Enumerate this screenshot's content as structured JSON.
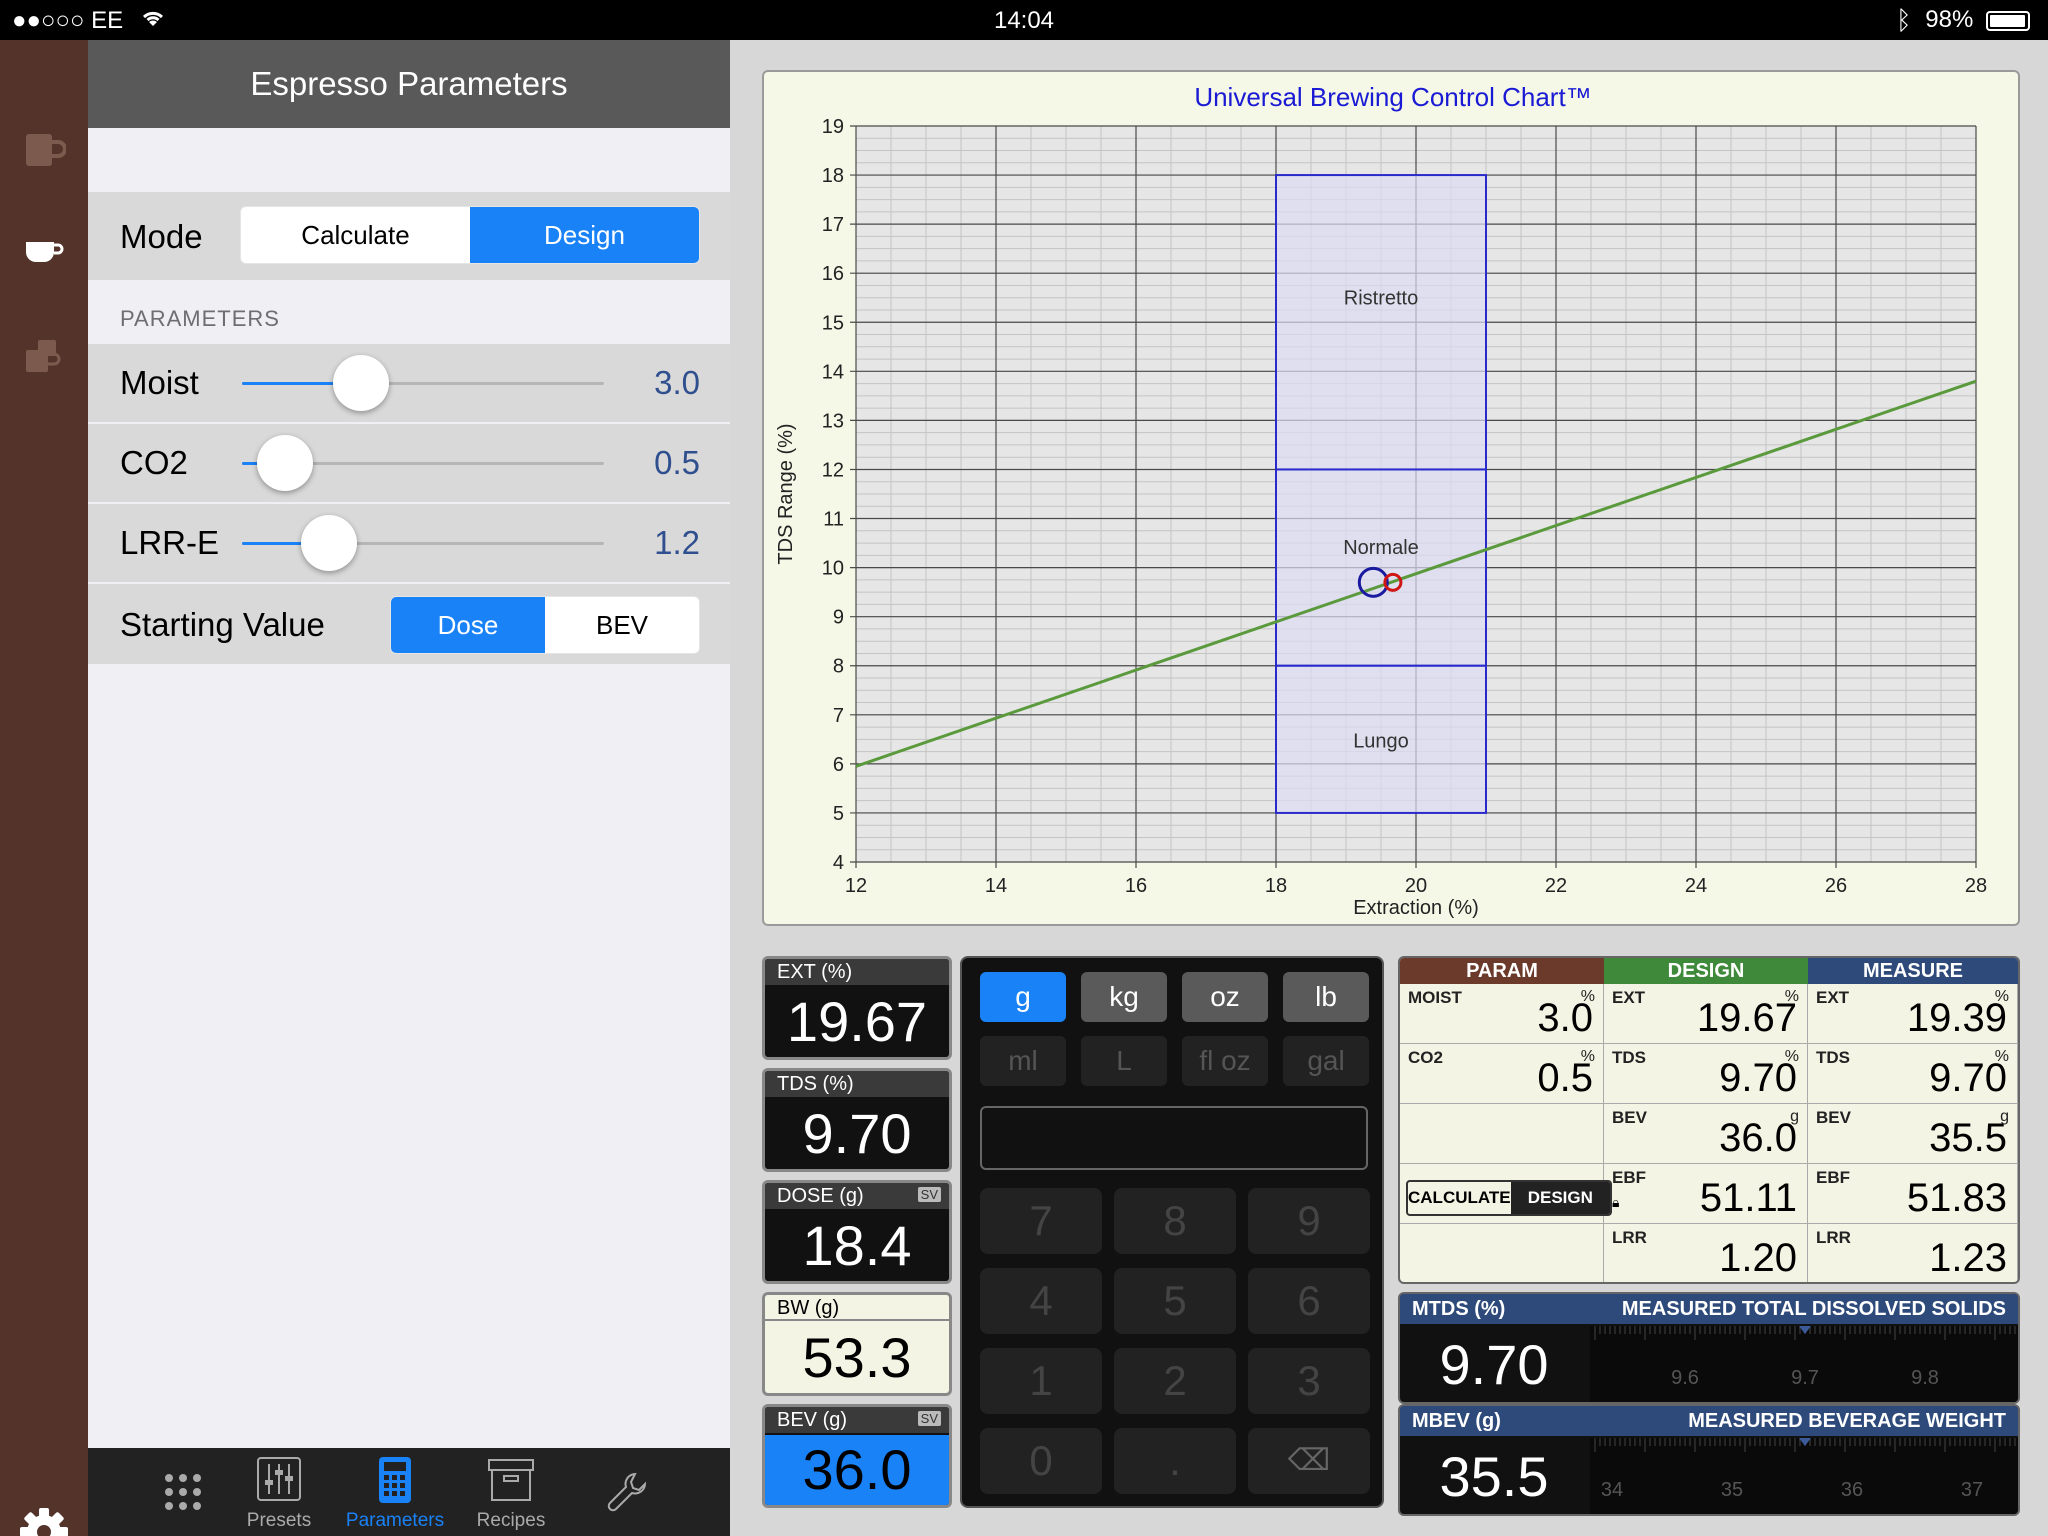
{
  "status": {
    "carrier": "●●○○○ EE",
    "time": "14:04",
    "battery_label": "98%",
    "battery_level": 0.98
  },
  "sidebar": {
    "icons": [
      "espresso-cup-icon",
      "coffee-cup-icon",
      "multiple-cups-icon"
    ],
    "settings_icon": "gear-icon"
  },
  "panel": {
    "title": "Espresso Parameters",
    "mode": {
      "label": "Mode",
      "options": [
        "Calculate",
        "Design"
      ],
      "selected": "Design"
    },
    "section_label": "PARAMETERS",
    "sliders": [
      {
        "label": "Moist",
        "value": "3.0",
        "fraction": 0.33
      },
      {
        "label": "CO2",
        "value": "0.5",
        "fraction": 0.12
      },
      {
        "label": "LRR-E",
        "value": "1.2",
        "fraction": 0.24
      }
    ],
    "starting_value": {
      "label": "Starting Value",
      "options": [
        "Dose",
        "BEV"
      ],
      "selected": "Dose"
    }
  },
  "tabbar": {
    "tabs": [
      {
        "label": "",
        "icon": "grid-icon"
      },
      {
        "label": "Presets",
        "icon": "sliders-icon"
      },
      {
        "label": "Parameters",
        "icon": "calculator-icon",
        "active": true
      },
      {
        "label": "Recipes",
        "icon": "archive-box-icon"
      },
      {
        "label": "",
        "icon": "wrench-icon"
      }
    ]
  },
  "chart_data": {
    "type": "line",
    "title": "Universal Brewing Control Chart™",
    "xlabel": "Extraction (%)",
    "ylabel": "TDS Range (%)",
    "xlim": [
      12,
      28
    ],
    "ylim": [
      4,
      19
    ],
    "xticks": [
      12,
      14,
      16,
      18,
      20,
      22,
      24,
      26,
      28
    ],
    "yticks": [
      4,
      5,
      6,
      7,
      8,
      9,
      10,
      11,
      12,
      13,
      14,
      15,
      16,
      17,
      18,
      19
    ],
    "grid": true,
    "regions": [
      {
        "label": "Ristretto",
        "x": [
          18,
          21
        ],
        "y": [
          12,
          18
        ]
      },
      {
        "label": "Normale",
        "x": [
          18,
          21
        ],
        "y": [
          8,
          12
        ]
      },
      {
        "label": "Lungo",
        "x": [
          18,
          21
        ],
        "y": [
          5,
          8
        ]
      }
    ],
    "series": [
      {
        "x": [
          12,
          28
        ],
        "y": [
          5.95,
          13.8
        ],
        "color": "#5a9a3c"
      }
    ],
    "points": [
      {
        "x": 19.39,
        "y": 9.7,
        "style": "blue-circle-large"
      },
      {
        "x": 19.67,
        "y": 9.7,
        "style": "red-circle-small"
      }
    ],
    "colors": {
      "grid": "#4a4a4a",
      "region": "#2a2acc",
      "region_fill": "#dcdcf2"
    }
  },
  "tiles": [
    {
      "label": "EXT (%)",
      "value": "19.67",
      "style": "dark",
      "sv": ""
    },
    {
      "label": "TDS (%)",
      "value": "9.70",
      "style": "dark",
      "sv": ""
    },
    {
      "label": "DOSE (g)",
      "value": "18.4",
      "style": "dark",
      "sv": "SV"
    },
    {
      "label": "BW (g)",
      "value": "53.3",
      "style": "light",
      "sv": ""
    },
    {
      "label": "BEV (g)",
      "value": "36.0",
      "style": "blue",
      "sv": "SV"
    }
  ],
  "keypad": {
    "units_row1": [
      {
        "label": "g",
        "on": true
      },
      {
        "label": "kg"
      },
      {
        "label": "oz"
      },
      {
        "label": "lb"
      }
    ],
    "units_row2": [
      {
        "label": "ml"
      },
      {
        "label": "L"
      },
      {
        "label": "fl oz"
      },
      {
        "label": "gal"
      }
    ],
    "keys": [
      "7",
      "8",
      "9",
      "4",
      "5",
      "6",
      "1",
      "2",
      "3",
      "0",
      ".",
      "⌫"
    ]
  },
  "results": {
    "headers": [
      {
        "label": "PARAM",
        "color": "#6b3a2a"
      },
      {
        "label": "DESIGN",
        "color": "#3f8a3a"
      },
      {
        "label": "MEASURE",
        "color": "#2e4a7a"
      }
    ],
    "param_col": [
      {
        "label": "MOIST",
        "unit": "%",
        "value": "3.0"
      },
      {
        "label": "CO2",
        "unit": "%",
        "value": "0.5"
      }
    ],
    "mode_pill": {
      "left": "CALCULATE",
      "right": "DESIGN",
      "selected": "DESIGN"
    },
    "design_col": [
      {
        "label": "EXT",
        "unit": "%",
        "value": "19.67"
      },
      {
        "label": "TDS",
        "unit": "%",
        "value": "9.70"
      },
      {
        "label": "BEV",
        "unit": "g",
        "value": "36.0"
      },
      {
        "label": "EBF",
        "unit": "",
        "value": "51.11",
        "lock": true
      },
      {
        "label": "LRR",
        "unit": "",
        "value": "1.20"
      }
    ],
    "measure_col": [
      {
        "label": "EXT",
        "unit": "%",
        "value": "19.39"
      },
      {
        "label": "TDS",
        "unit": "%",
        "value": "9.70"
      },
      {
        "label": "BEV",
        "unit": "g",
        "value": "35.5"
      },
      {
        "label": "EBF",
        "unit": "",
        "value": "51.83"
      },
      {
        "label": "LRR",
        "unit": "",
        "value": "1.23"
      }
    ]
  },
  "measured": [
    {
      "label": "MTDS (%)",
      "title": "MEASURED TOTAL DISSOLVED SOLIDS",
      "value": "9.70",
      "ticks": [
        "9.6",
        "9.7",
        "9.8"
      ]
    },
    {
      "label": "MBEV (g)",
      "title": "MEASURED BEVERAGE WEIGHT",
      "value": "35.5",
      "ticks": [
        "34",
        "35",
        "36",
        "37"
      ]
    }
  ]
}
